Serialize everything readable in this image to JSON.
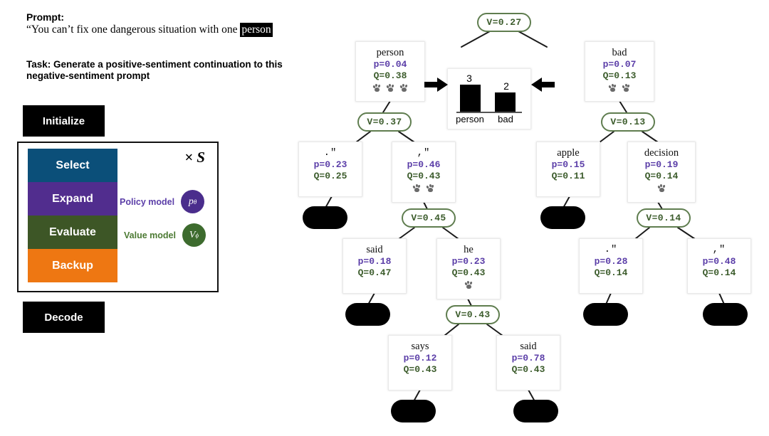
{
  "left_panel": {
    "prompt_label": "Prompt:",
    "prompt_prefix": "“You can’t fix one dangerous situation with one ",
    "prompt_highlight": "person",
    "task_text": "Task: Generate a positive-sentiment continuation to this negative-sentiment prompt",
    "initialize_label": "Initialize",
    "decode_label": "Decode",
    "loop_multiplier": "× S",
    "stages": [
      {
        "label": "Select",
        "color": "#0b4f79"
      },
      {
        "label": "Expand",
        "color": "#512d8e"
      },
      {
        "label": "Evaluate",
        "color": "#3d5626"
      },
      {
        "label": "Backup",
        "color": "#ee7712"
      }
    ],
    "models": [
      {
        "label": "Policy model",
        "symbol": "p",
        "subscript": "θ",
        "color": "#4a2d8c",
        "text_color": "#5b3ea8"
      },
      {
        "label": "Value model",
        "symbol": "V",
        "subscript": "ϕ",
        "color": "#3d6b2e",
        "text_color": "#4c7a33"
      }
    ]
  },
  "chart_data": {
    "type": "bar",
    "title": "",
    "categories": [
      "person",
      "bad"
    ],
    "values": [
      3,
      2
    ],
    "value_labels": [
      "3",
      "2"
    ],
    "xlabel": "",
    "ylabel": "",
    "ylim": [
      0,
      3.6
    ],
    "grid": false,
    "legend": "none",
    "bar_color": "#000000",
    "description": "Visit counts at the two root children of the MCTS tree"
  },
  "tree": {
    "value_nodes": [
      {
        "id": "v-root",
        "label": "V=0.27"
      },
      {
        "id": "v-person",
        "label": "V=0.37"
      },
      {
        "id": "v-bad",
        "label": "V=0.13"
      },
      {
        "id": "v-comma",
        "label": "V=0.45"
      },
      {
        "id": "v-decision",
        "label": "V=0.14"
      },
      {
        "id": "v-he",
        "label": "V=0.43"
      }
    ],
    "token_nodes": [
      {
        "id": "t-person",
        "token": "person",
        "p": "p=0.04",
        "q": "Q=0.38",
        "paws": 3,
        "quoted": false
      },
      {
        "id": "t-bad",
        "token": "bad",
        "p": "p=0.07",
        "q": "Q=0.13",
        "paws": 2,
        "quoted": false
      },
      {
        "id": "t-dotq-1",
        "token": ".\"",
        "p": "p=0.23",
        "q": "Q=0.25",
        "paws": 0,
        "quoted": true
      },
      {
        "id": "t-commaq-1",
        "token": ",\"",
        "p": "p=0.46",
        "q": "Q=0.43",
        "paws": 2,
        "quoted": true
      },
      {
        "id": "t-apple",
        "token": "apple",
        "p": "p=0.15",
        "q": "Q=0.11",
        "paws": 0,
        "quoted": false
      },
      {
        "id": "t-decision",
        "token": "decision",
        "p": "p=0.19",
        "q": "Q=0.14",
        "paws": 1,
        "quoted": false
      },
      {
        "id": "t-said-1",
        "token": "said",
        "p": "p=0.18",
        "q": "Q=0.47",
        "paws": 0,
        "quoted": false
      },
      {
        "id": "t-he",
        "token": "he",
        "p": "p=0.23",
        "q": "Q=0.43",
        "paws": 1,
        "quoted": false
      },
      {
        "id": "t-dotq-2",
        "token": ".\"",
        "p": "p=0.28",
        "q": "Q=0.14",
        "paws": 0,
        "quoted": true
      },
      {
        "id": "t-commaq-2",
        "token": ",\"",
        "p": "p=0.48",
        "q": "Q=0.14",
        "paws": 0,
        "quoted": true
      },
      {
        "id": "t-says",
        "token": "says",
        "p": "p=0.12",
        "q": "Q=0.43",
        "paws": 0,
        "quoted": false
      },
      {
        "id": "t-said-2",
        "token": "said",
        "p": "p=0.78",
        "q": "Q=0.43",
        "paws": 0,
        "quoted": false
      }
    ],
    "accent_green": "#5f7d4f",
    "policy_purple": "#5b3ea8",
    "value_green": "#3c5c2c"
  }
}
